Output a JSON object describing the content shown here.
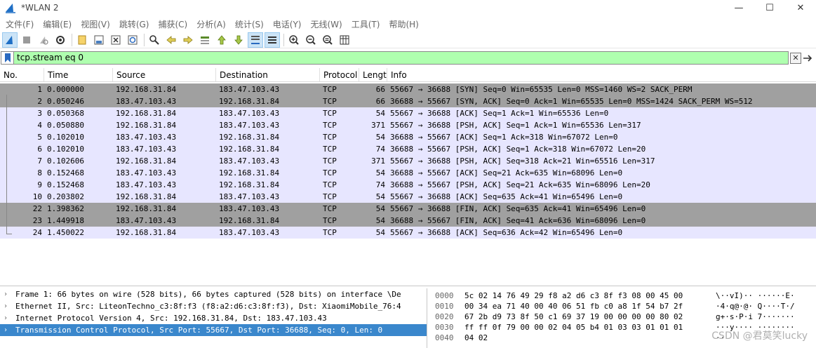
{
  "window": {
    "title": "*WLAN 2",
    "controls": {
      "minimize": "—",
      "maximize": "☐",
      "close": "✕"
    }
  },
  "menu": [
    "文件(F)",
    "编辑(E)",
    "视图(V)",
    "跳转(G)",
    "捕获(C)",
    "分析(A)",
    "统计(S)",
    "电话(Y)",
    "无线(W)",
    "工具(T)",
    "帮助(H)"
  ],
  "toolbar_icons": [
    "shark-fin-start-icon",
    "stop-icon",
    "restart-icon",
    "options-gear-icon",
    "open-file-icon",
    "save-file-icon",
    "close-file-icon",
    "reload-icon",
    "find-icon",
    "go-back-icon",
    "go-forward-icon",
    "go-to-packet-icon",
    "first-packet-icon",
    "last-packet-icon",
    "auto-scroll-icon",
    "colorize-icon",
    "zoom-in-icon",
    "zoom-out-icon",
    "zoom-normal-icon",
    "resize-columns-icon"
  ],
  "filter": {
    "value": "tcp.stream eq 0",
    "clear_label": "✕"
  },
  "columns": [
    "No.",
    "Time",
    "Source",
    "Destination",
    "Protocol",
    "Length",
    "Info"
  ],
  "packets": [
    {
      "no": "1",
      "time": "0.000000",
      "src": "192.168.31.84",
      "dst": "183.47.103.43",
      "proto": "TCP",
      "len": "66",
      "info": "55667 → 36688 [SYN] Seq=0 Win=65535 Len=0 MSS=1460 WS=2 SACK_PERM",
      "bg": "#a0a0a0"
    },
    {
      "no": "2",
      "time": "0.050246",
      "src": "183.47.103.43",
      "dst": "192.168.31.84",
      "proto": "TCP",
      "len": "66",
      "info": "36688 → 55667 [SYN, ACK] Seq=0 Ack=1 Win=65535 Len=0 MSS=1424 SACK_PERM WS=512",
      "bg": "#a0a0a0"
    },
    {
      "no": "3",
      "time": "0.050368",
      "src": "192.168.31.84",
      "dst": "183.47.103.43",
      "proto": "TCP",
      "len": "54",
      "info": "55667 → 36688 [ACK] Seq=1 Ack=1 Win=65536 Len=0",
      "bg": "#e7e6ff"
    },
    {
      "no": "4",
      "time": "0.050880",
      "src": "192.168.31.84",
      "dst": "183.47.103.43",
      "proto": "TCP",
      "len": "371",
      "info": "55667 → 36688 [PSH, ACK] Seq=1 Ack=1 Win=65536 Len=317",
      "bg": "#e7e6ff"
    },
    {
      "no": "5",
      "time": "0.102010",
      "src": "183.47.103.43",
      "dst": "192.168.31.84",
      "proto": "TCP",
      "len": "54",
      "info": "36688 → 55667 [ACK] Seq=1 Ack=318 Win=67072 Len=0",
      "bg": "#e7e6ff"
    },
    {
      "no": "6",
      "time": "0.102010",
      "src": "183.47.103.43",
      "dst": "192.168.31.84",
      "proto": "TCP",
      "len": "74",
      "info": "36688 → 55667 [PSH, ACK] Seq=1 Ack=318 Win=67072 Len=20",
      "bg": "#e7e6ff"
    },
    {
      "no": "7",
      "time": "0.102606",
      "src": "192.168.31.84",
      "dst": "183.47.103.43",
      "proto": "TCP",
      "len": "371",
      "info": "55667 → 36688 [PSH, ACK] Seq=318 Ack=21 Win=65516 Len=317",
      "bg": "#e7e6ff"
    },
    {
      "no": "8",
      "time": "0.152468",
      "src": "183.47.103.43",
      "dst": "192.168.31.84",
      "proto": "TCP",
      "len": "54",
      "info": "36688 → 55667 [ACK] Seq=21 Ack=635 Win=68096 Len=0",
      "bg": "#e7e6ff"
    },
    {
      "no": "9",
      "time": "0.152468",
      "src": "183.47.103.43",
      "dst": "192.168.31.84",
      "proto": "TCP",
      "len": "74",
      "info": "36688 → 55667 [PSH, ACK] Seq=21 Ack=635 Win=68096 Len=20",
      "bg": "#e7e6ff"
    },
    {
      "no": "10",
      "time": "0.203802",
      "src": "192.168.31.84",
      "dst": "183.47.103.43",
      "proto": "TCP",
      "len": "54",
      "info": "55667 → 36688 [ACK] Seq=635 Ack=41 Win=65496 Len=0",
      "bg": "#e7e6ff"
    },
    {
      "no": "22",
      "time": "1.398362",
      "src": "192.168.31.84",
      "dst": "183.47.103.43",
      "proto": "TCP",
      "len": "54",
      "info": "55667 → 36688 [FIN, ACK] Seq=635 Ack=41 Win=65496 Len=0",
      "bg": "#a0a0a0"
    },
    {
      "no": "23",
      "time": "1.449918",
      "src": "183.47.103.43",
      "dst": "192.168.31.84",
      "proto": "TCP",
      "len": "54",
      "info": "36688 → 55667 [FIN, ACK] Seq=41 Ack=636 Win=68096 Len=0",
      "bg": "#a0a0a0"
    },
    {
      "no": "24",
      "time": "1.450022",
      "src": "192.168.31.84",
      "dst": "183.47.103.43",
      "proto": "TCP",
      "len": "54",
      "info": "55667 → 36688 [ACK] Seq=636 Ack=42 Win=65496 Len=0",
      "bg": "#e7e6ff"
    }
  ],
  "details": [
    {
      "text": "Frame 1: 66 bytes on wire (528 bits), 66 bytes captured (528 bits) on interface \\De",
      "selected": false
    },
    {
      "text": "Ethernet II, Src: LiteonTechno_c3:8f:f3 (f8:a2:d6:c3:8f:f3), Dst: XiaomiMobile_76:4",
      "selected": false
    },
    {
      "text": "Internet Protocol Version 4, Src: 192.168.31.84, Dst: 183.47.103.43",
      "selected": false
    },
    {
      "text": "Transmission Control Protocol, Src Port: 55667, Dst Port: 36688, Seq: 0, Len: 0",
      "selected": true
    }
  ],
  "bytes": [
    {
      "offset": "0000",
      "hex": "5c 02 14 76 49 29 f8 a2  d6 c3 8f f3 08 00 45 00",
      "ascii": "\\··vI)·· ······E·"
    },
    {
      "offset": "0010",
      "hex": "00 34 ea 71 40 00 40 06  51 fb c0 a8 1f 54 b7 2f",
      "ascii": "·4·q@·@· Q····T·/"
    },
    {
      "offset": "0020",
      "hex": "67 2b d9 73 8f 50 c1 69  37 19 00 00 00 00 80 02",
      "ascii": "g+·s·P·i 7·······"
    },
    {
      "offset": "0030",
      "hex": "ff ff 0f 79 00 00 02 04  05 b4 01 03 03 01 01 01",
      "ascii": "···y···· ········"
    },
    {
      "offset": "0040",
      "hex": "04 02",
      "ascii": "··"
    }
  ],
  "watermark": "CSDN @君莫笑lucky"
}
